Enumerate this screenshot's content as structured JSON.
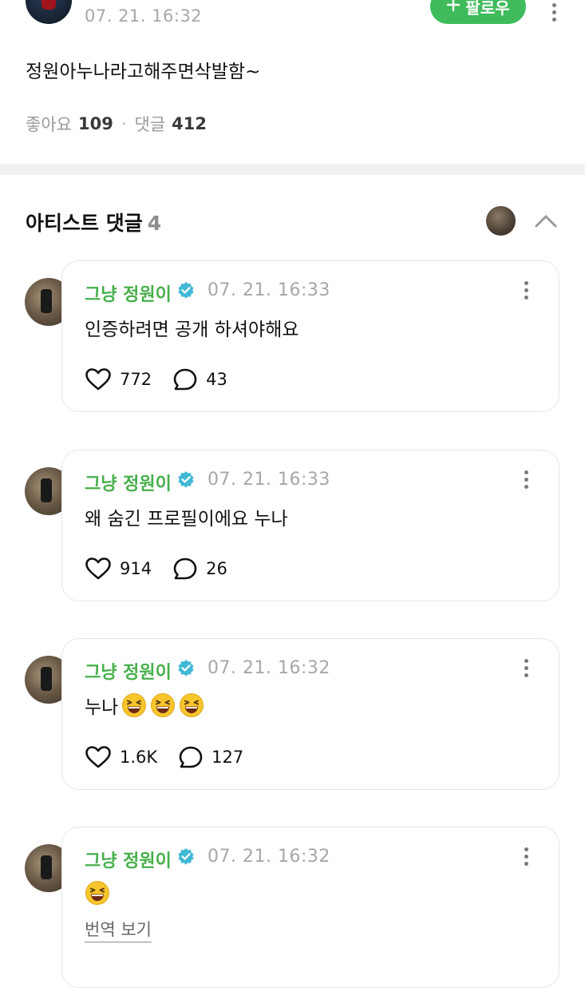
{
  "post": {
    "time": "07. 21. 16:32",
    "follow_label": "팔로우",
    "text": "정원아누나라고해주면삭발함~",
    "likes_label": "좋아요",
    "likes_count": "109",
    "comments_label": "댓글",
    "comments_count": "412"
  },
  "section": {
    "title": "아티스트 댓글",
    "count": "4"
  },
  "comments": [
    {
      "author": "그냥 정원이",
      "time": "07. 21. 16:33",
      "text": "인증하려면 공개 하셔야해요",
      "likes": "772",
      "replies": "43"
    },
    {
      "author": "그냥 정원이",
      "time": "07. 21. 16:33",
      "text": "왜 숨긴 프로필이에요 누나",
      "likes": "914",
      "replies": "26"
    },
    {
      "author": "그냥 정원이",
      "time": "07. 21. 16:32",
      "text": "누나",
      "emoji_count": 3,
      "likes": "1.6K",
      "replies": "127"
    },
    {
      "author": "그냥 정원이",
      "time": "07. 21. 16:32",
      "text": "",
      "emoji_count": 1,
      "translate_label": "번역 보기"
    }
  ],
  "colors": {
    "accent_green": "#47b04b",
    "follow_green": "#3fbb5b",
    "verified_blue": "#41b8d5"
  },
  "icons": [
    "plus-icon",
    "more-vertical-icon",
    "chevron-up-icon",
    "verified-badge-icon",
    "heart-icon",
    "comment-bubble-icon",
    "laughing-emoji-icon"
  ]
}
